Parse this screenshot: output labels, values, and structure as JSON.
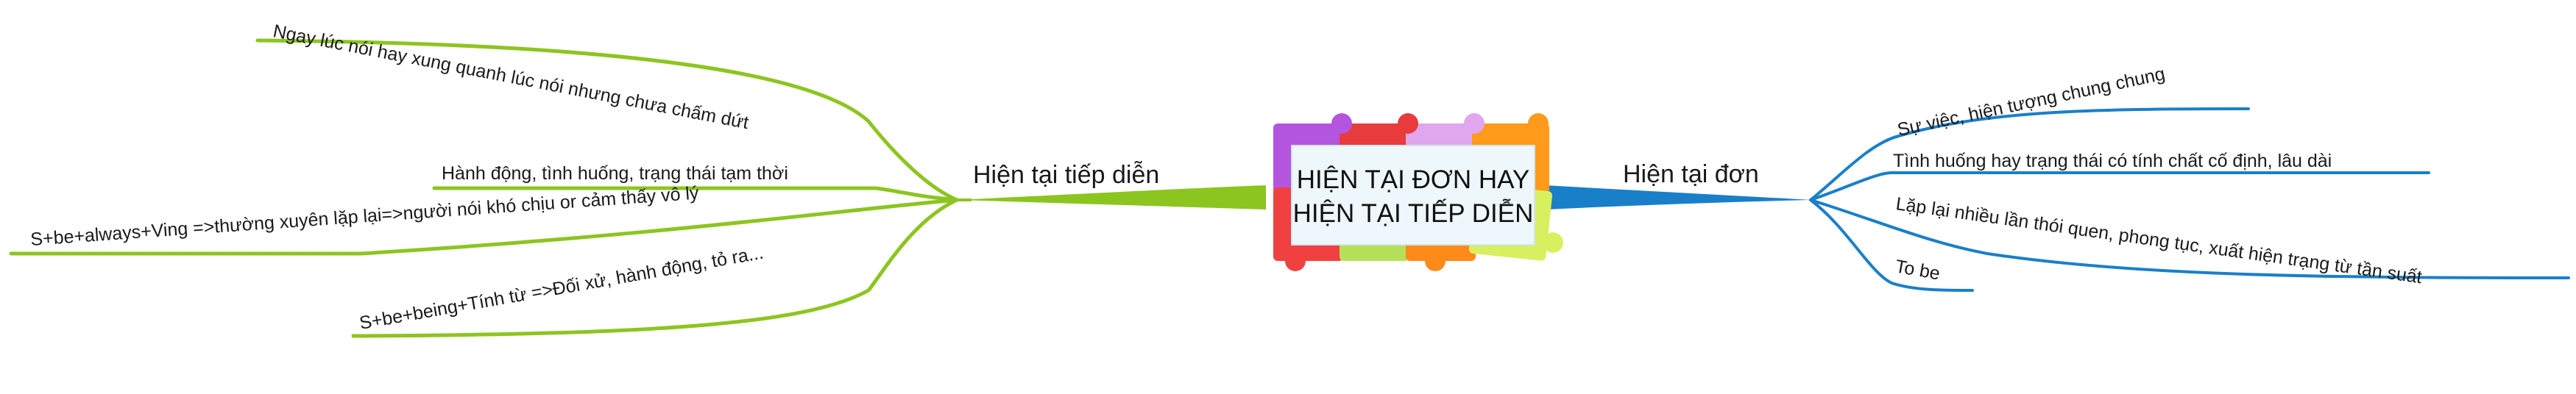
{
  "center": {
    "line1": "HIỆN TẠI ĐƠN HAY",
    "line2": "HIỆN TẠI TIẾP DIỄN"
  },
  "left": {
    "title": "Hiện tại tiếp diễn",
    "color": "#8cc520",
    "items": [
      "Ngay lúc nói hay xung quanh lúc nói nhưng chưa chấm dứt",
      "Hành động, tình huống, trạng thái tạm thời",
      "S+be+always+Ving =>thường xuyên lặp lại=>người nói khó chịu or cảm thấy vô lý",
      "S+be+being+Tính từ =>Đối xử, hành động, tỏ ra..."
    ]
  },
  "right": {
    "title": "Hiện tại đơn",
    "color": "#1a7fc9",
    "items": [
      "Sự việc, hiện tượng chung chung",
      "Tình huống hay trạng thái có tính chất cố định, lâu dài",
      "Lặp lại nhiều lần thói quen, phong tục, xuất hiện trạng từ tần suất",
      "To be"
    ]
  },
  "puzzle_colors": [
    "#b455e0",
    "#e83b3b",
    "#e0a6ee",
    "#ff9a1a",
    "#f04040",
    "#b6e05a",
    "#ff8a1a",
    "#d8f060"
  ]
}
